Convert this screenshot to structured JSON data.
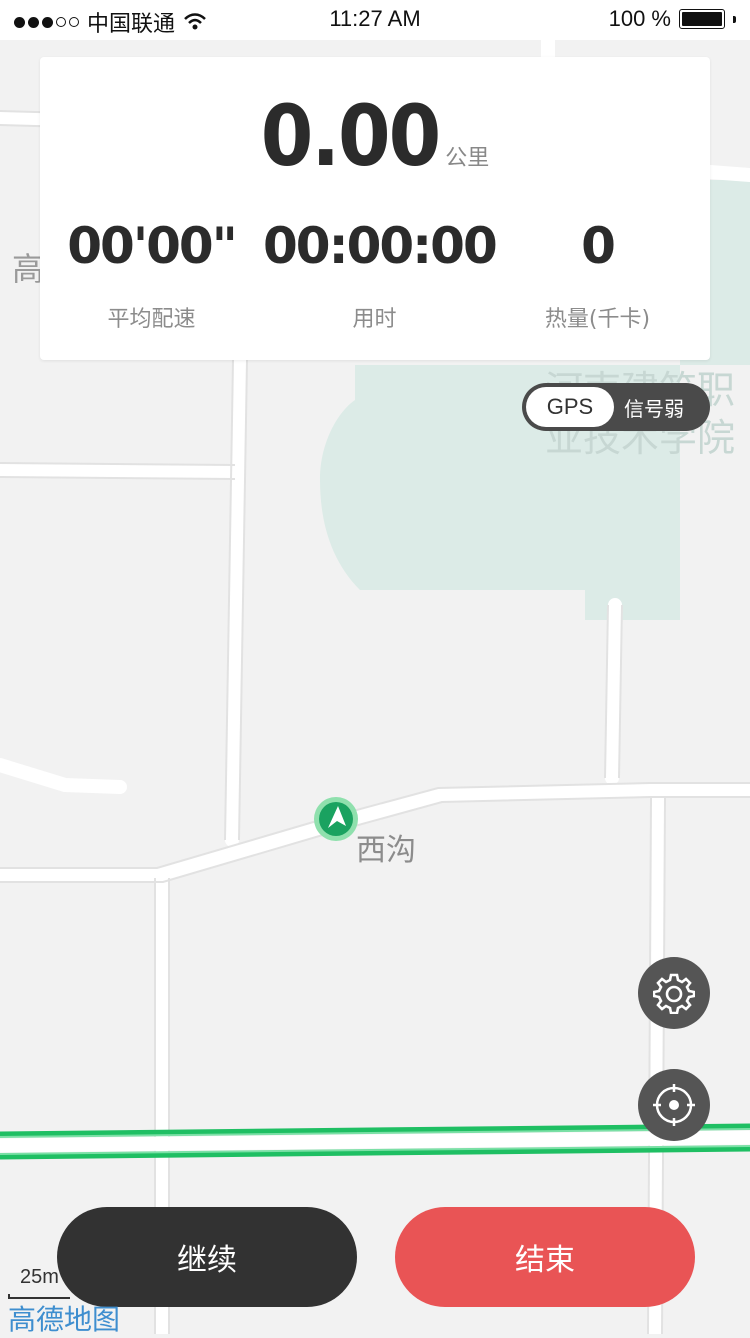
{
  "status_bar": {
    "carrier": "中国联通",
    "time": "11:27 AM",
    "battery_text": "100 %",
    "signal_dots_filled": 3,
    "signal_dots_total": 5,
    "battery_level": 1.0
  },
  "stats": {
    "distance_value": "0.00",
    "distance_unit": "公里",
    "metrics": [
      {
        "value": "00'00\"",
        "label": "平均配速"
      },
      {
        "value": "00:00:00",
        "label": "用时"
      },
      {
        "value": "0",
        "label": "热量(千卡)"
      }
    ]
  },
  "gps": {
    "tag": "GPS",
    "status": "信号弱"
  },
  "map": {
    "left_label": "高",
    "campus_label_line1": "河南建筑职",
    "campus_label_line2": "业技术学院",
    "place_label": "西沟",
    "scale": "25m",
    "brand": "高德地图",
    "route_color": "#1fbf63",
    "campus_color": "#dcebe7"
  },
  "controls": {
    "continue_label": "继续",
    "end_label": "结束",
    "settings_icon": "gear-icon",
    "locate_icon": "crosshair-icon"
  },
  "colors": {
    "end_button": "#e95455",
    "continue_button": "#323232",
    "location_marker": "#1aa260"
  }
}
